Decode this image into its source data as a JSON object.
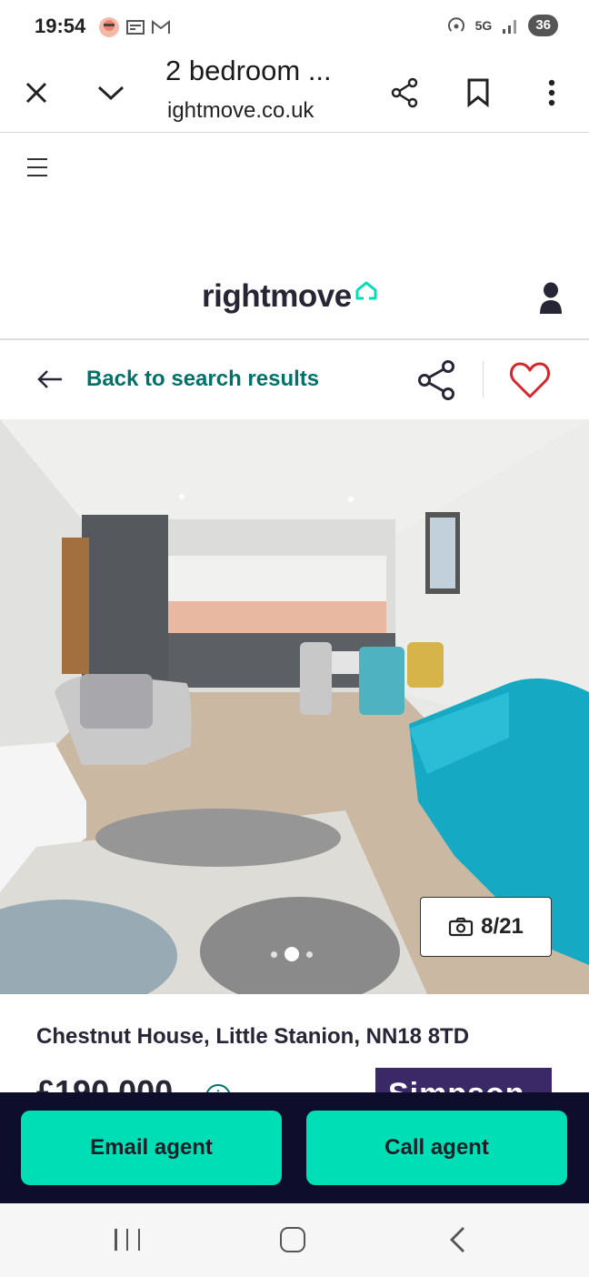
{
  "status_bar": {
    "time": "19:54",
    "network": "5G",
    "battery": "36",
    "icons": [
      "avatar-icon",
      "news-icon",
      "gmail-icon",
      "hotspot-icon",
      "signal-icon"
    ]
  },
  "browser": {
    "title": "2 bedroom ...",
    "url": "ightmove.co.uk",
    "icons": [
      "close-icon",
      "chevron-down-icon",
      "share-icon",
      "bookmark-icon",
      "more-icon"
    ]
  },
  "site": {
    "logo_text": "rightmove",
    "brand_color": "#00deb6",
    "link_color": "#00726a",
    "back_label": "Back to search results"
  },
  "gallery": {
    "counter": "8/21",
    "dots": 4,
    "active_dot": 2
  },
  "listing": {
    "address": "Chestnut House, Little Stanion, NN18 8TD",
    "price": "£190,000",
    "agent_logo_text": "Simpson"
  },
  "actions": {
    "email_label": "Email agent",
    "call_label": "Call agent",
    "bar_color": "#0e0d2b"
  }
}
